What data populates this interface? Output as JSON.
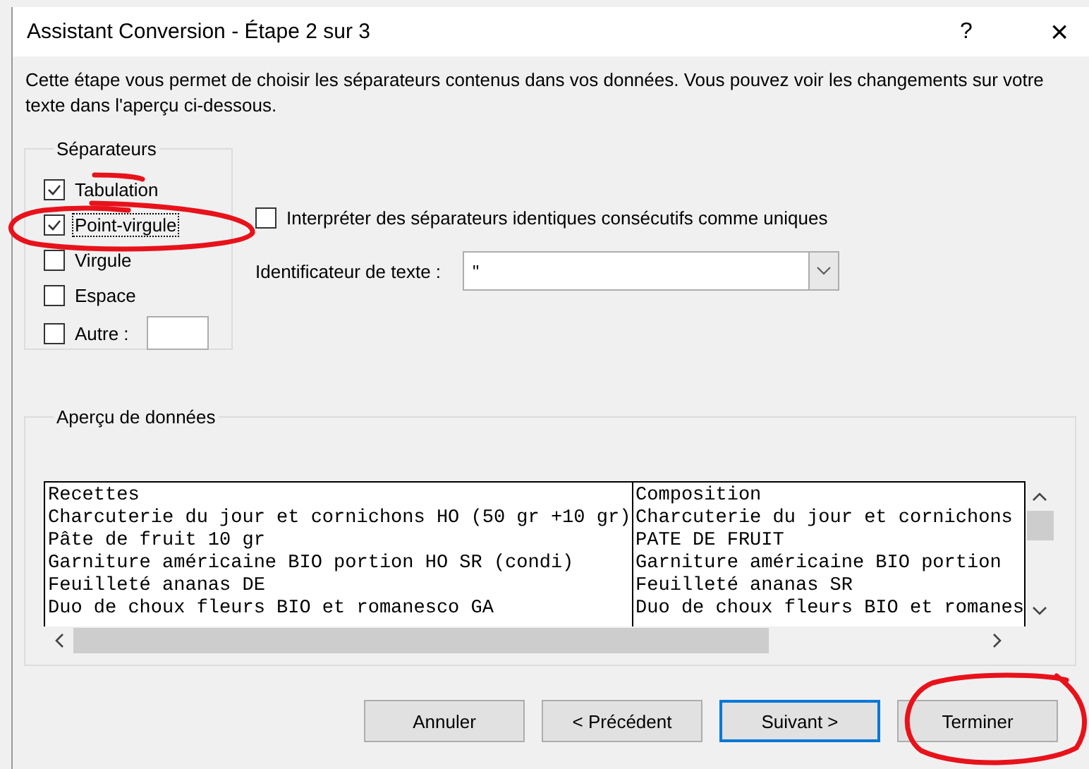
{
  "window": {
    "title": "Assistant Conversion - Étape 2 sur 3",
    "help": "?",
    "close": "×"
  },
  "description": "Cette étape vous permet de choisir les séparateurs contenus dans vos données. Vous pouvez voir les changements sur votre texte dans l'aperçu ci-dessous.",
  "separators": {
    "legend": "Séparateurs",
    "items": [
      {
        "label": "Tabulation",
        "checked": true,
        "focused": false,
        "kind": "check"
      },
      {
        "label": "Point-virgule",
        "checked": true,
        "focused": true,
        "kind": "check"
      },
      {
        "label": "Virgule",
        "checked": false,
        "focused": false,
        "kind": "check"
      },
      {
        "label": "Espace",
        "checked": false,
        "focused": false,
        "kind": "check"
      },
      {
        "label": "Autre :",
        "checked": false,
        "focused": false,
        "kind": "other"
      }
    ]
  },
  "consecutive": {
    "label": "Interpréter des séparateurs identiques consécutifs comme uniques",
    "checked": false
  },
  "text_qualifier": {
    "label": "Identificateur de texte :",
    "value": "\""
  },
  "preview": {
    "legend": "Aperçu de données",
    "rows": [
      [
        "Recettes",
        "Composition"
      ],
      [
        "Charcuterie du jour et cornichons HO (50 gr +10 gr)",
        "Charcuterie du jour et cornichons"
      ],
      [
        "Pâte de fruit 10 gr",
        "PATE DE FRUIT"
      ],
      [
        "Garniture américaine BIO portion HO SR (condi)",
        "Garniture américaine BIO portion"
      ],
      [
        "Feuilleté ananas DE",
        "Feuilleté ananas SR"
      ],
      [
        "Duo de choux fleurs BIO et romanesco GA",
        "Duo de choux fleurs BIO et romanes"
      ]
    ]
  },
  "buttons": [
    {
      "label": "Annuler",
      "default": false
    },
    {
      "label": "< Précédent",
      "default": false
    },
    {
      "label": "Suivant >",
      "default": true
    },
    {
      "label": "Terminer",
      "default": false
    }
  ]
}
